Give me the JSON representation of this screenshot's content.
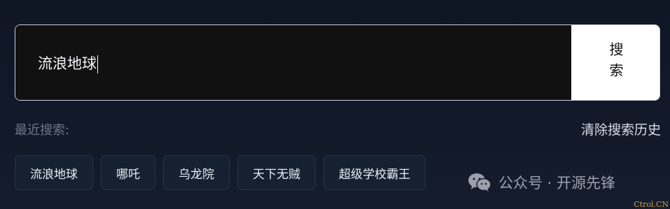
{
  "search": {
    "value": "流浪地球",
    "button_label": "搜索"
  },
  "history": {
    "label": "最近搜索:",
    "clear_label": "清除搜索历史",
    "items": [
      "流浪地球",
      "哪吒",
      "乌龙院",
      "天下无贼",
      "超级学校霸王"
    ]
  },
  "watermark": {
    "text": "公众号 · 开源先锋",
    "icon": "wechat-icon",
    "corner": "Ctrol.CN"
  },
  "colors": {
    "background": "#0f1624",
    "input_bg": "#111111",
    "tag_bg": "#152131",
    "tag_border": "#263447",
    "label_muted": "#6f7786"
  }
}
